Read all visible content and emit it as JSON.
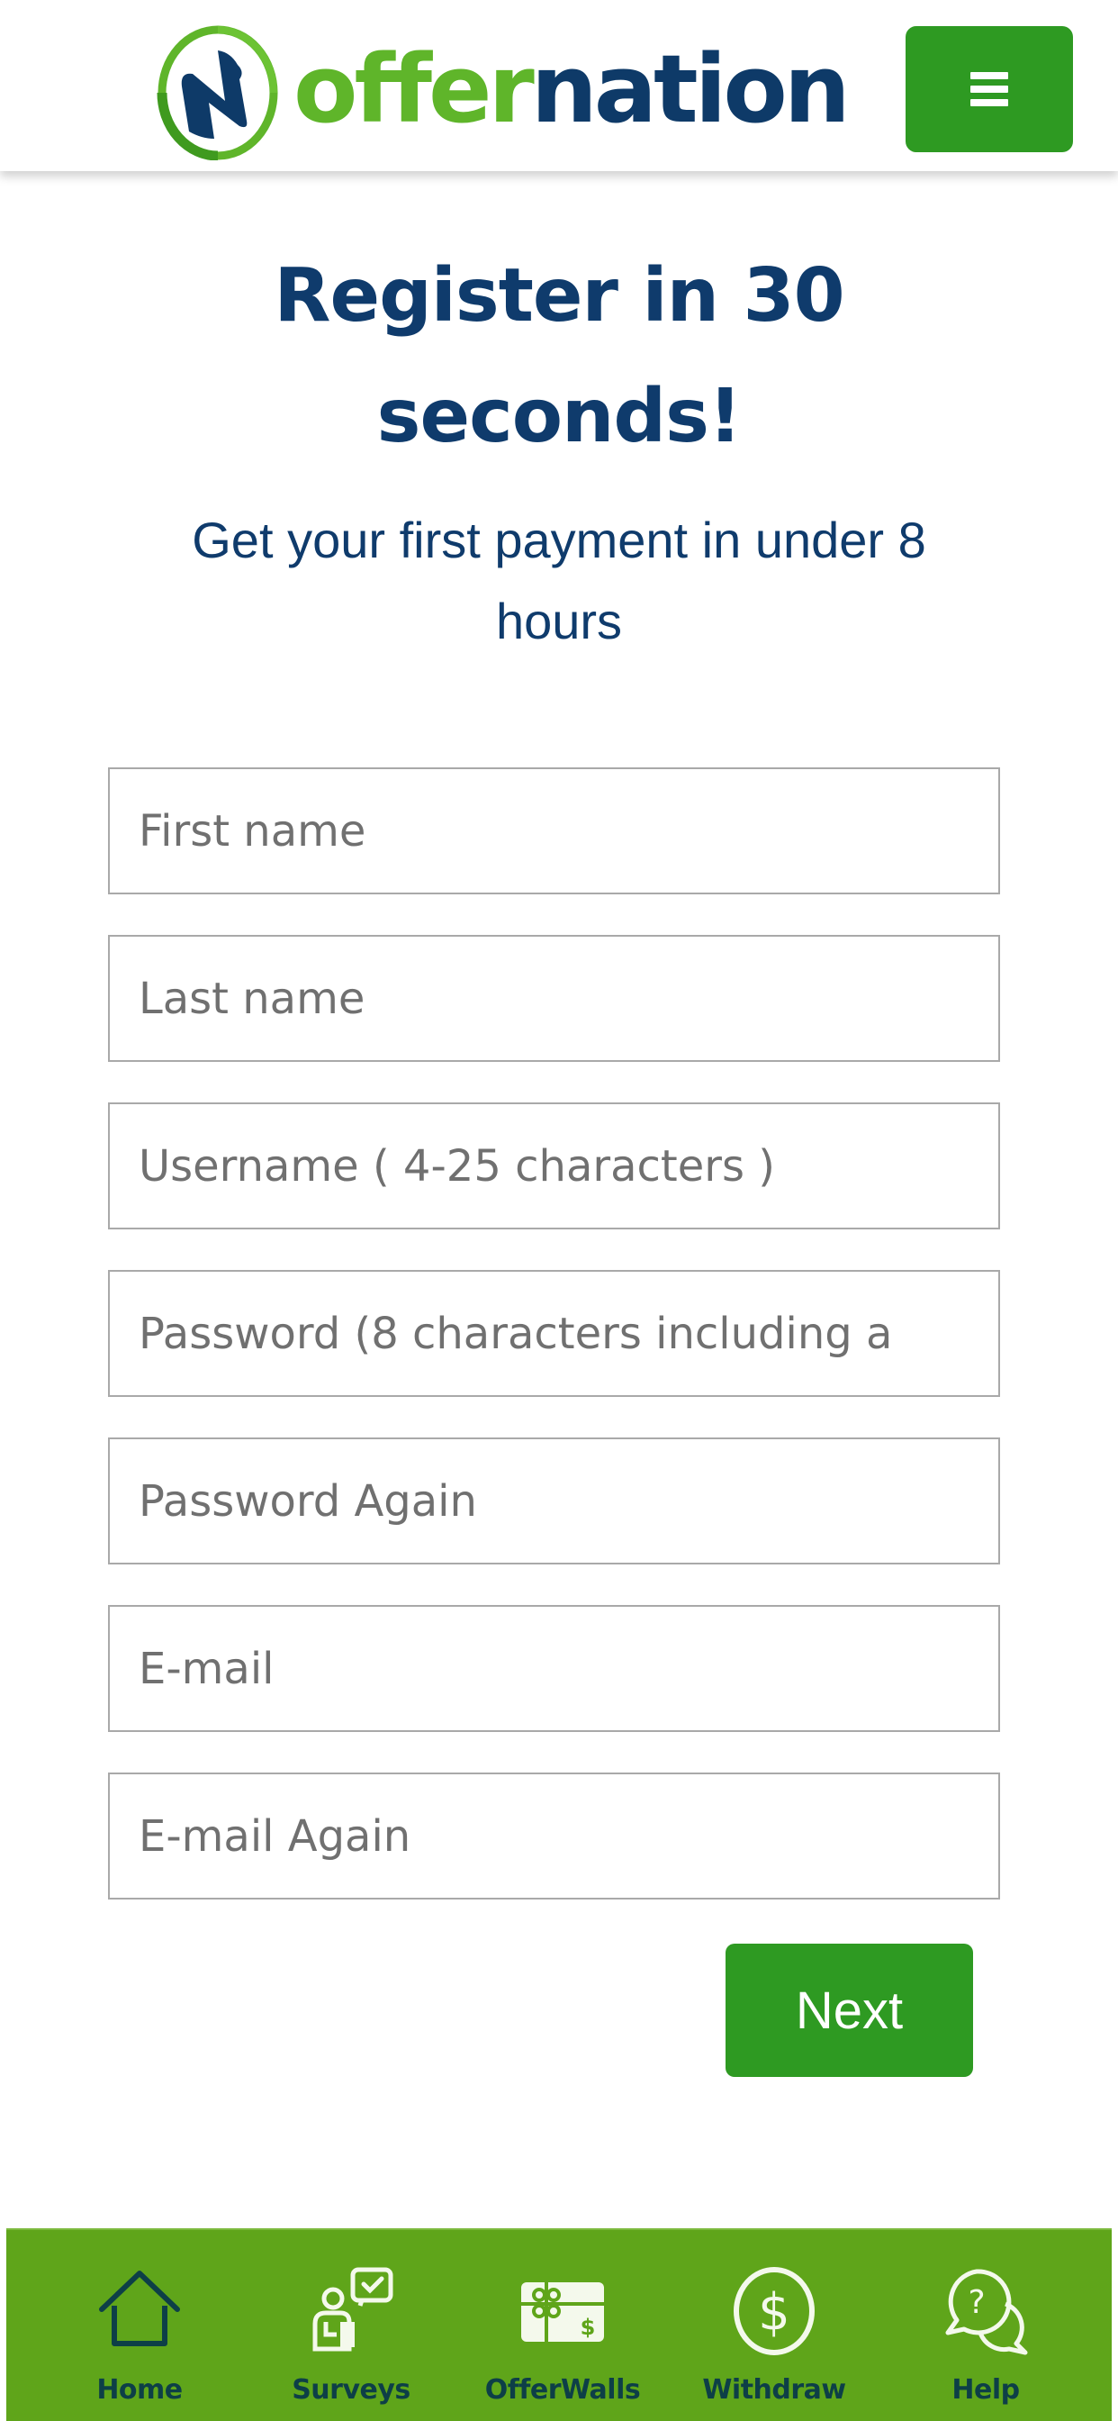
{
  "header": {
    "brand": {
      "part1": "offer",
      "part2": "nation",
      "colors": {
        "green": "#5fb52a",
        "navy": "#0e3a68"
      }
    },
    "menu_icon": "hamburger-menu-icon"
  },
  "hero": {
    "title_line1": "Register in 30",
    "title_line2": "seconds!",
    "subtitle_line1": "Get your first payment in under 8",
    "subtitle_line2": "hours"
  },
  "form": {
    "fields": [
      {
        "name": "first-name",
        "placeholder": "First name",
        "value": ""
      },
      {
        "name": "last-name",
        "placeholder": "Last name",
        "value": ""
      },
      {
        "name": "username",
        "placeholder": "Username ( 4-25 characters )",
        "value": ""
      },
      {
        "name": "password",
        "placeholder": "Password (8 characters including a",
        "value": ""
      },
      {
        "name": "password-again",
        "placeholder": "Password Again",
        "value": ""
      },
      {
        "name": "email",
        "placeholder": "E-mail",
        "value": ""
      },
      {
        "name": "email-again",
        "placeholder": "E-mail Again",
        "value": ""
      }
    ],
    "next_label": "Next"
  },
  "bottom_nav": {
    "items": [
      {
        "label": "Home",
        "icon": "home-icon",
        "active": true
      },
      {
        "label": "Surveys",
        "icon": "survey-person-icon",
        "active": false
      },
      {
        "label": "OfferWalls",
        "icon": "gift-card-icon",
        "active": false
      },
      {
        "label": "Withdraw",
        "icon": "dollar-coin-icon",
        "active": false
      },
      {
        "label": "Help",
        "icon": "help-chat-icon",
        "active": false
      }
    ]
  },
  "colors": {
    "primary_green": "#2e9a22",
    "nav_green": "#5fa51a",
    "heading_navy": "#0f3b6c",
    "nav_label": "#0d3f47",
    "input_border": "#a9a9a9",
    "placeholder": "#707070"
  }
}
